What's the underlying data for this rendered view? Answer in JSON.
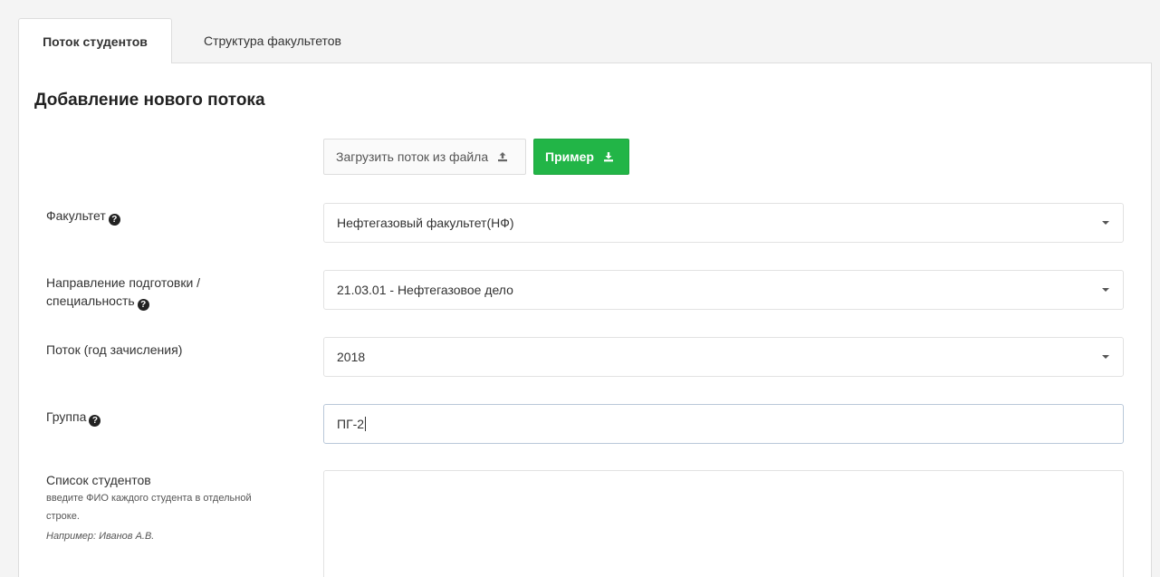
{
  "tabs": [
    {
      "label": "Поток студентов",
      "active": true
    },
    {
      "label": "Структура факультетов",
      "active": false
    }
  ],
  "form": {
    "title": "Добавление нового потока",
    "upload_label": "Загрузить поток из файла",
    "sample_label": "Пример",
    "faculty": {
      "label": "Факультет",
      "value": "Нефтегазовый факультет(НФ)"
    },
    "direction": {
      "label_line1": "Направление подготовки /",
      "label_line2": "специальность",
      "value": "21.03.01 - Нефтегазовое дело"
    },
    "stream": {
      "label": "Поток (год зачисления)",
      "value": "2018"
    },
    "group": {
      "label": "Группа",
      "value": "ПГ-2"
    },
    "students": {
      "label": "Список студентов",
      "hint_line1": "введите ФИО каждого студента в отдельной",
      "hint_line2": "строке.",
      "example": "Например: Иванов А.В.",
      "value": ""
    }
  },
  "colors": {
    "accent_green": "#22b547",
    "background": "#f4f4f4"
  },
  "icons": {
    "help": "question-circle-icon",
    "upload": "upload-icon",
    "download": "download-icon"
  }
}
